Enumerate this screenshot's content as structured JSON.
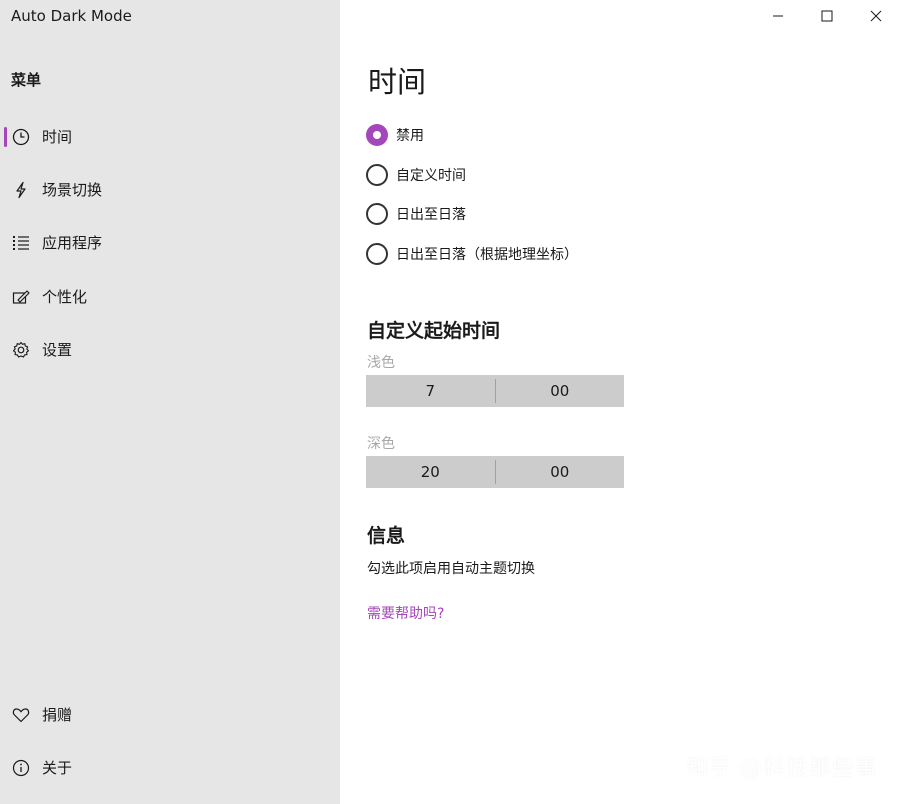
{
  "app": {
    "title": "Auto Dark Mode"
  },
  "sidebar": {
    "menu_header": "菜单",
    "items": [
      {
        "label": "时间",
        "icon": "clock-icon",
        "selected": true
      },
      {
        "label": "场景切换",
        "icon": "lightning-icon",
        "selected": false
      },
      {
        "label": "应用程序",
        "icon": "list-icon",
        "selected": false
      },
      {
        "label": "个性化",
        "icon": "paint-icon",
        "selected": false
      },
      {
        "label": "设置",
        "icon": "gear-icon",
        "selected": false
      }
    ],
    "bottom_items": [
      {
        "label": "捐赠",
        "icon": "heart-icon"
      },
      {
        "label": "关于",
        "icon": "info-icon"
      }
    ]
  },
  "window_controls": {
    "icons": [
      "minimize-icon",
      "maximize-icon",
      "close-icon"
    ]
  },
  "main": {
    "title": "时间",
    "options": [
      {
        "label": "禁用",
        "checked": true
      },
      {
        "label": "自定义时间",
        "checked": false
      },
      {
        "label": "日出至日落",
        "checked": false
      },
      {
        "label": "日出至日落（根据地理坐标）",
        "checked": false
      }
    ],
    "custom_start": {
      "title": "自定义起始时间",
      "light": {
        "label": "浅色",
        "hour": "7",
        "minute": "00"
      },
      "dark": {
        "label": "深色",
        "hour": "20",
        "minute": "00"
      }
    },
    "info": {
      "title": "信息",
      "text": "勾选此项启用自动主题切换",
      "help_link": "需要帮助吗?"
    }
  },
  "watermark": "知乎 @科技那些事",
  "colors": {
    "accent": "#a347ba",
    "sidebar_bg": "#e6e6e6",
    "picker_bg": "#cccccc"
  }
}
